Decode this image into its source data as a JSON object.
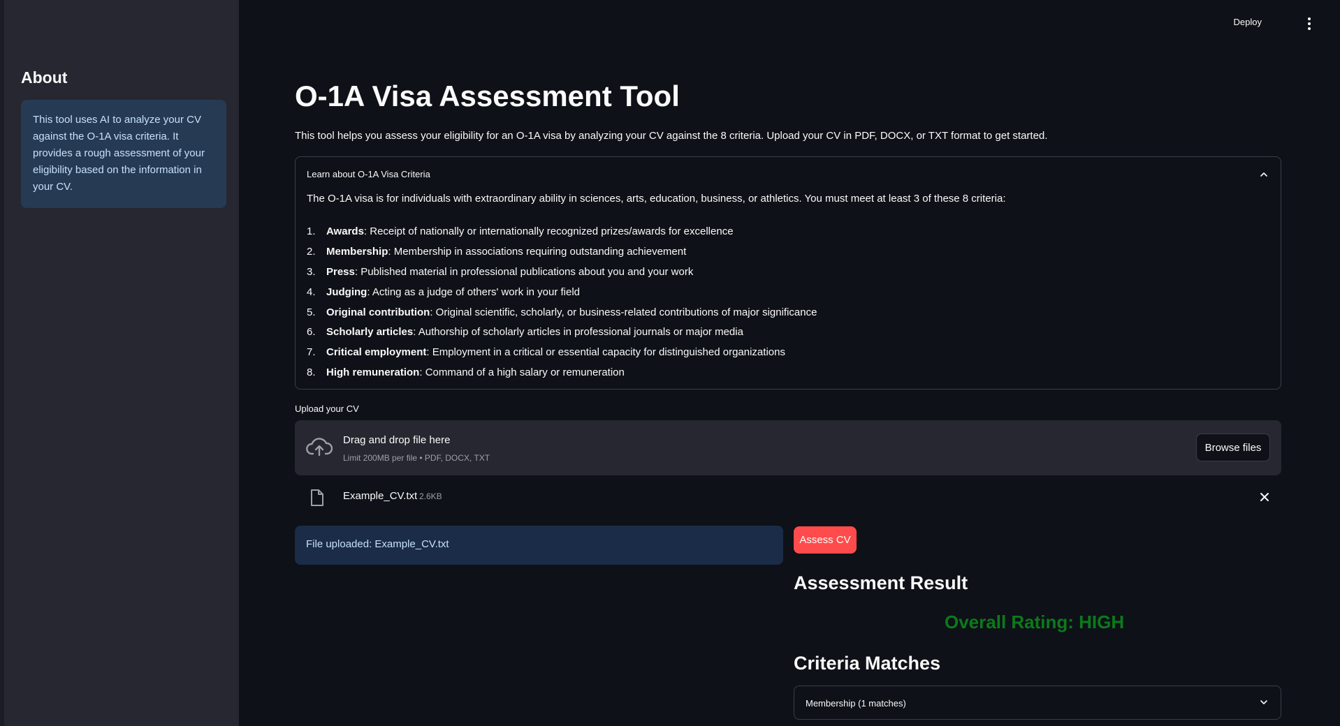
{
  "sidebar": {
    "heading": "About",
    "info": "This tool uses AI to analyze your CV against the O-1A visa criteria. It provides a rough assessment of your eligibility based on the information in your CV."
  },
  "topbar": {
    "deploy_label": "Deploy",
    "menu_icon": "kebab-menu-icon"
  },
  "main": {
    "title": "O-1A Visa Assessment Tool",
    "subtitle": "This tool helps you assess your eligibility for an O-1A visa by analyzing your CV against the 8 criteria. Upload your CV in PDF, DOCX, or TXT format to get started."
  },
  "criteria_expander": {
    "header": "Learn about O-1A Visa Criteria",
    "expanded": true,
    "intro": "The O-1A visa is for individuals with extraordinary ability in sciences, arts, education, business, or athletics. You must meet at least 3 of these 8 criteria:",
    "items": [
      {
        "num": "1.",
        "name": "Awards",
        "desc": ": Receipt of nationally or internationally recognized prizes/awards for excellence"
      },
      {
        "num": "2.",
        "name": "Membership",
        "desc": ": Membership in associations requiring outstanding achievement"
      },
      {
        "num": "3.",
        "name": "Press",
        "desc": ": Published material in professional publications about you and your work"
      },
      {
        "num": "4.",
        "name": "Judging",
        "desc": ": Acting as a judge of others' work in your field"
      },
      {
        "num": "5.",
        "name": "Original contribution",
        "desc": ": Original scientific, scholarly, or business-related contributions of major significance"
      },
      {
        "num": "6.",
        "name": "Scholarly articles",
        "desc": ": Authorship of scholarly articles in professional journals or major media"
      },
      {
        "num": "7.",
        "name": "Critical employment",
        "desc": ": Employment in a critical or essential capacity for distinguished organizations"
      },
      {
        "num": "8.",
        "name": "High remuneration",
        "desc": ": Command of a high salary or remuneration"
      }
    ]
  },
  "uploader": {
    "label": "Upload your CV",
    "drop_text": "Drag and drop file here",
    "limit_text": "Limit 200MB per file • PDF, DOCX, TXT",
    "browse_label": "Browse files",
    "file": {
      "name": "Example_CV.txt",
      "size": "2.6KB"
    }
  },
  "status": {
    "uploaded_message": "File uploaded: Example_CV.txt"
  },
  "assessment": {
    "button_label": "Assess CV",
    "result_heading": "Assessment Result",
    "overall_rating": "Overall Rating: HIGH",
    "overall_color": "#0b7a1c",
    "criteria_heading": "Criteria Matches",
    "matches": [
      {
        "label": "Membership (1 matches)"
      }
    ]
  },
  "colors": {
    "background": "#0e1117",
    "sidebar": "#262730",
    "info_box": "#263a53",
    "primary_button": "#ff4b4b"
  }
}
